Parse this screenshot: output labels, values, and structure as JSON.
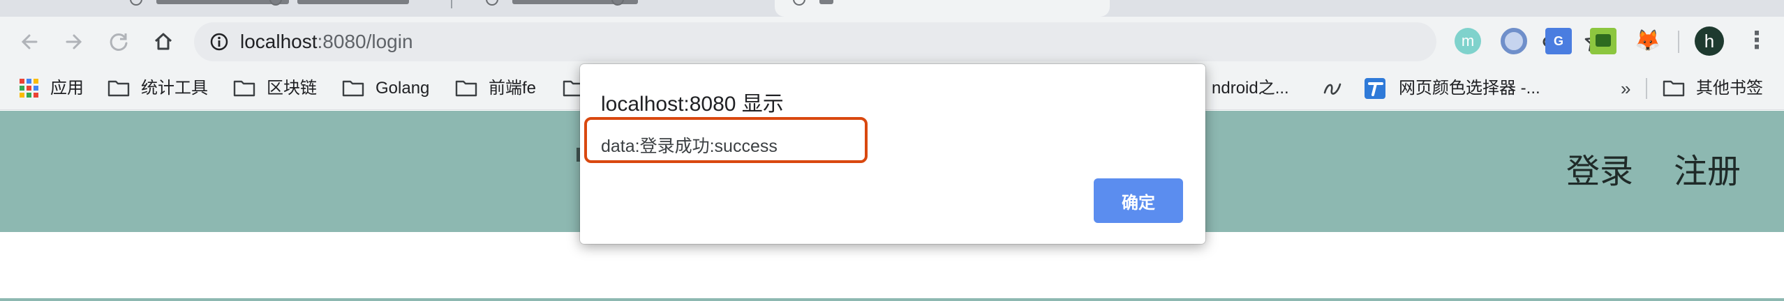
{
  "browser": {
    "url_host": "localhost",
    "url_path": ":8080/login",
    "profile_initial": "h",
    "extensions": [
      "m-extension-icon",
      "ring-extension-icon",
      "google-translate-icon",
      "green-extension-icon",
      "metamask-fox-icon"
    ],
    "ext_m_label": "m",
    "ext_translate_label": "G"
  },
  "bookmarks": [
    {
      "label": "应用",
      "icon": "apps-grid-icon"
    },
    {
      "label": "统计工具",
      "icon": "folder-icon"
    },
    {
      "label": "区块链",
      "icon": "folder-icon"
    },
    {
      "label": "Golang",
      "icon": "folder-icon"
    },
    {
      "label": "前端fe",
      "icon": "folder-icon"
    },
    {
      "label": "ndroid之...",
      "icon": "none"
    },
    {
      "label": "",
      "icon": "script-logo-icon"
    },
    {
      "label": "网页颜色选择器 -...",
      "icon": "t-logo-icon"
    },
    {
      "label": "»",
      "icon": "chevron-icon"
    },
    {
      "label": "其他书签",
      "icon": "folder-icon"
    }
  ],
  "page": {
    "nav_login": "登录",
    "nav_register": "注册"
  },
  "dialog": {
    "title": "localhost:8080 显示",
    "message": "data:登录成功:success",
    "ok_label": "确定"
  },
  "colors": {
    "page_band": "#8db8b1",
    "ok_button": "#5b8def",
    "highlight_border": "#d9480f",
    "toolbar": "#f1f3f4"
  }
}
